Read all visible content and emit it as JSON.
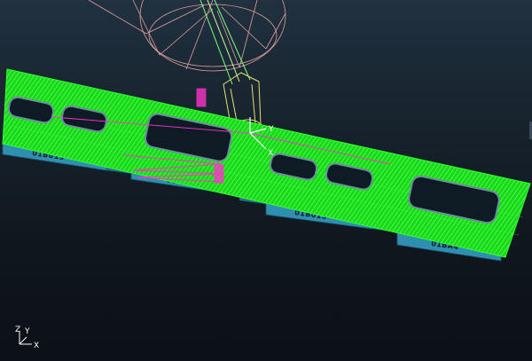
{
  "colors": {
    "background_top": "#203140",
    "background_bottom": "#0b1016",
    "toolpath": "#2bff2b",
    "stock": "#2f8fb0",
    "tool_holder": "#e0a0a0",
    "tool": "#7cff7c",
    "highlight": "#ff33cc"
  },
  "parts": {
    "labels": [
      "01B013",
      "01BA4",
      "01B013",
      "01BA4"
    ]
  },
  "tool_triad": {
    "y_label": "Y",
    "x_label": "X"
  },
  "view_triad": {
    "z_label": "Z",
    "y_label": "Y",
    "x_label": "X"
  }
}
